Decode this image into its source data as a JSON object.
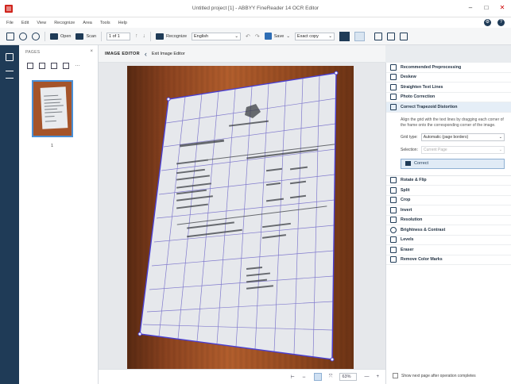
{
  "window": {
    "title": "Untitled project [1] - ABBYY FineReader 14 OCR Editor",
    "controls": [
      "–",
      "□",
      "✕"
    ]
  },
  "menu": {
    "items": [
      "File",
      "Edit",
      "View",
      "Recognize",
      "Area",
      "Tools",
      "Help"
    ],
    "settings_icon": "gear-icon",
    "help_icon": "help-icon"
  },
  "toolbar": {
    "open": "Open",
    "scan": "Scan",
    "page_value": "1 of 1",
    "recognize": "Recognize",
    "language": "English",
    "save": "Save",
    "save_format": "Exact copy"
  },
  "pages_pane": {
    "header": "PAGES",
    "close": "×",
    "page_number": "1"
  },
  "editor_header": {
    "title": "IMAGE EDITOR",
    "exit_label": "Exit Image Editor",
    "back_glyph": "‹"
  },
  "right_panel": {
    "items_top": [
      "Recommended Preprocessing",
      "Deskew",
      "Straighten Text Lines",
      "Photo Correction",
      "Correct Trapezoid Distortion"
    ],
    "description": "Align the grid with the text lines by dragging each corner of the frame onto the corresponding corner of the image.",
    "grid_type_label": "Grid type:",
    "grid_type_value": "Automatic (page borders)",
    "selection_label": "Selection:",
    "selection_value": "Current Page",
    "correct_label": "Correct",
    "items_bottom": [
      "Rotate & Flip",
      "Split",
      "Crop",
      "Invert",
      "Resolution",
      "Brightness & Contrast",
      "Levels",
      "Eraser",
      "Remove Color Marks"
    ],
    "footer_checkbox": "Show next page after operation completes"
  },
  "statusbar": {
    "zoom": "63%",
    "minus": "—",
    "plus": "+"
  }
}
